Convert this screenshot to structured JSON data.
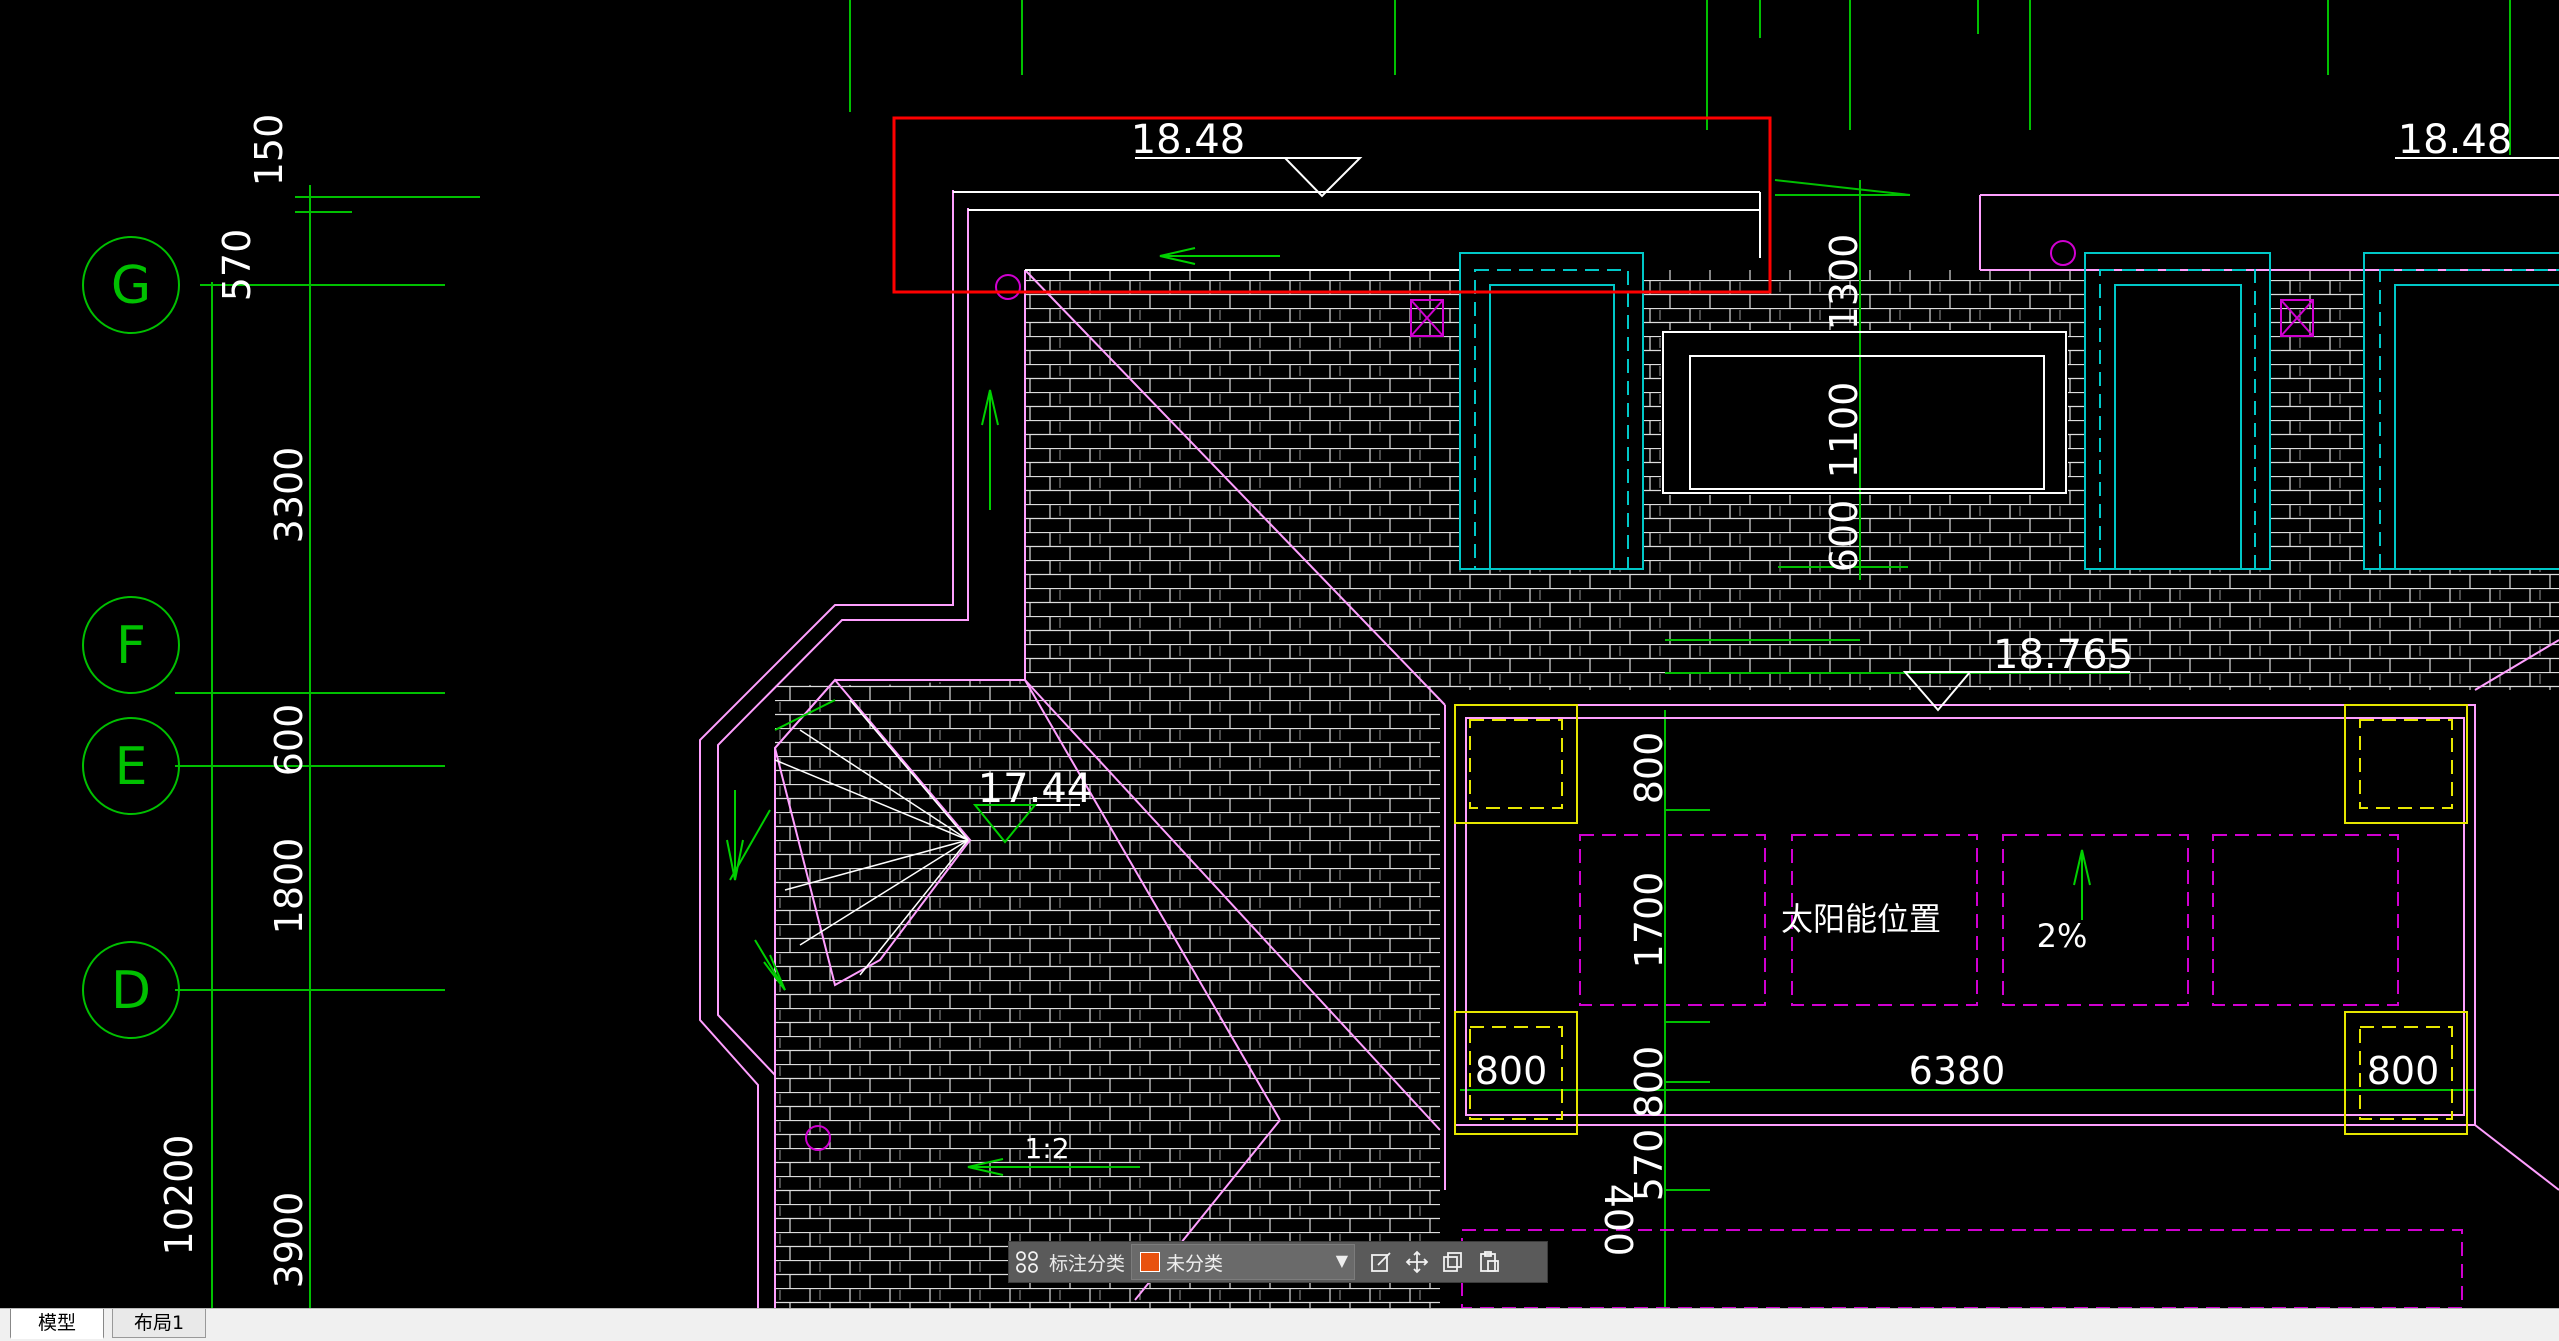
{
  "drawing": {
    "axis_labels": [
      "G",
      "F",
      "E",
      "D"
    ],
    "left_dims": [
      "150",
      "570",
      "3300",
      "600",
      "1800",
      "3900",
      "10200"
    ],
    "elevations": [
      "18.48",
      "18.48",
      "18.765",
      "17.44"
    ],
    "dims": [
      "1300",
      "1100",
      "600",
      "800",
      "1700",
      "800",
      "570",
      "400",
      "800",
      "6380",
      "800"
    ],
    "slope_ratio": "1:2",
    "slope_percent": "2%",
    "solar_label": "太阳能位置",
    "colors": {
      "axis": "#00c000",
      "wall": "#ff9fff",
      "window": "#00c8c8",
      "column": "#e6e600",
      "solar": "#d000d0",
      "tile": "#ffffff",
      "highlight": "#ff0000",
      "arrow": "#00d000"
    }
  },
  "toolbar": {
    "label": "标注分类",
    "selected_value": "未分类",
    "swatch_color": "#e8520f",
    "icons": [
      "grid-icon",
      "edit-icon",
      "move-icon",
      "copy-icon",
      "paste-icon"
    ]
  },
  "tabs": {
    "model": "模型",
    "layout": "布局1"
  }
}
